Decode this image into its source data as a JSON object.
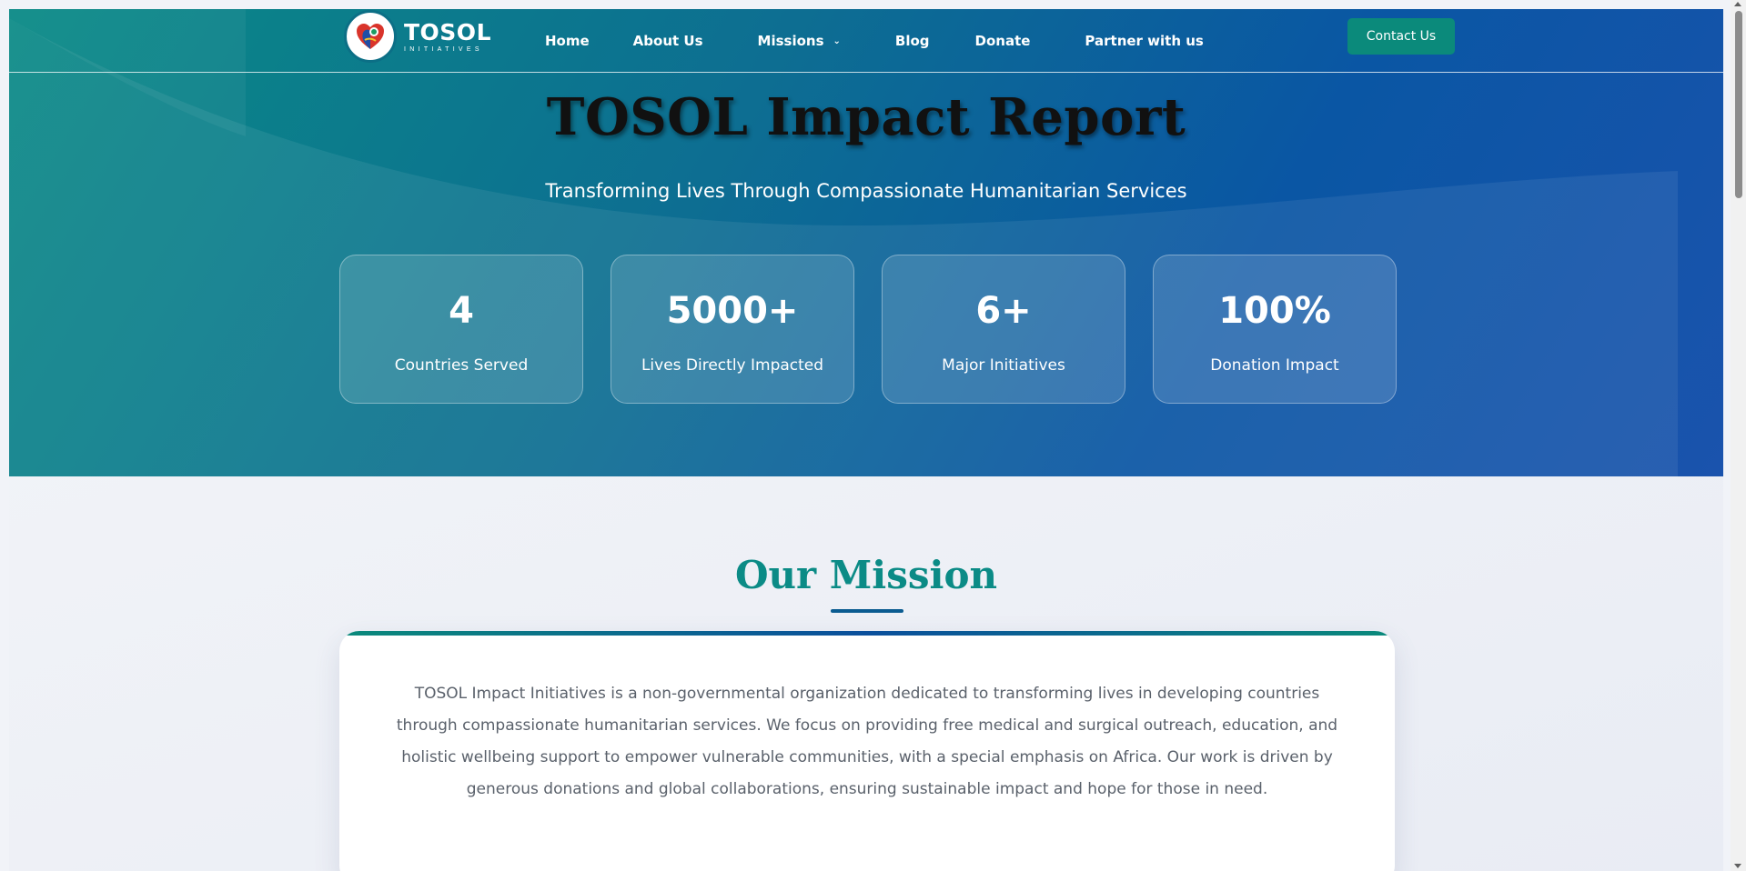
{
  "brand": {
    "name": "TOSOL",
    "tagline": "INITIATIVES",
    "logo_icon": "heart-globe-icon",
    "colors": {
      "teal": "#0b8a7b",
      "blue": "#0b56a4",
      "title_teal": "#0b8b86"
    }
  },
  "nav": {
    "items": [
      {
        "label": "Home"
      },
      {
        "label": "About Us"
      },
      {
        "label": "Missions",
        "has_dropdown": true
      },
      {
        "label": "Blog"
      },
      {
        "label": "Donate"
      },
      {
        "label": "Partner with us"
      }
    ],
    "contact_label": "Contact Us"
  },
  "hero": {
    "title": "TOSOL Impact Report",
    "subtitle": "Transforming Lives Through Compassionate Humanitarian Services"
  },
  "stats": [
    {
      "value": "4",
      "label": "Countries Served"
    },
    {
      "value": "5000+",
      "label": "Lives Directly Impacted"
    },
    {
      "value": "6+",
      "label": "Major Initiatives"
    },
    {
      "value": "100%",
      "label": "Donation Impact"
    }
  ],
  "mission": {
    "title": "Our Mission",
    "lines": [
      "TOSOL Impact Initiatives is a non-governmental organization dedicated to transforming lives in developing countries",
      "through compassionate humanitarian services. We focus on providing free medical and surgical outreach, education, and",
      "holistic wellbeing support to empower vulnerable communities, with a special emphasis on Africa. Our work is driven by",
      "generous donations and global collaborations, ensuring sustainable impact and hope for those in need."
    ]
  }
}
